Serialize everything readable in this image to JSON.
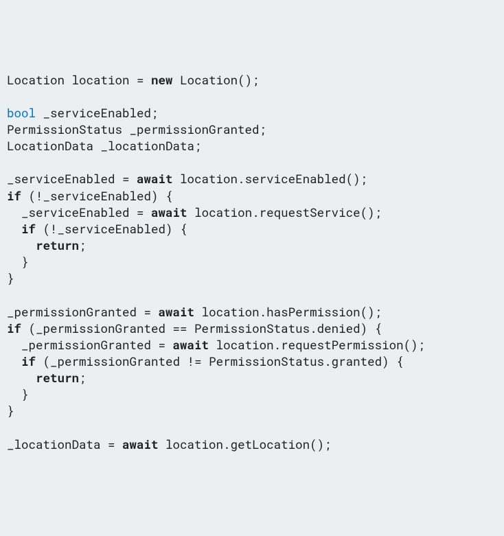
{
  "code": {
    "l1_t1": "Location location = ",
    "l1_k1": "new",
    "l1_t2": " Location();",
    "l3_ty": "bool",
    "l3_t1": " _serviceEnabled;",
    "l4_t1": "PermissionStatus _permissionGranted;",
    "l5_t1": "LocationData _locationData;",
    "l7_t1": "_serviceEnabled = ",
    "l7_k1": "await",
    "l7_t2": " location.serviceEnabled();",
    "l8_k1": "if",
    "l8_t1": " (!_serviceEnabled) {",
    "l9_t1": "  _serviceEnabled = ",
    "l9_k1": "await",
    "l9_t2": " location.requestService();",
    "l10_t1": "  ",
    "l10_k1": "if",
    "l10_t2": " (!_serviceEnabled) {",
    "l11_t1": "    ",
    "l11_k1": "return",
    "l11_t2": ";",
    "l12_t1": "  }",
    "l13_t1": "}",
    "l15_t1": "_permissionGranted = ",
    "l15_k1": "await",
    "l15_t2": " location.hasPermission();",
    "l16_k1": "if",
    "l16_t1": " (_permissionGranted == PermissionStatus.denied) {",
    "l17_t1": "  _permissionGranted = ",
    "l17_k1": "await",
    "l17_t2": " location.requestPermission();",
    "l18_t1": "  ",
    "l18_k1": "if",
    "l18_t2": " (_permissionGranted != PermissionStatus.granted) {",
    "l19_t1": "    ",
    "l19_k1": "return",
    "l19_t2": ";",
    "l20_t1": "  }",
    "l21_t1": "}",
    "l23_t1": "_locationData = ",
    "l23_k1": "await",
    "l23_t2": " location.getLocation();"
  }
}
